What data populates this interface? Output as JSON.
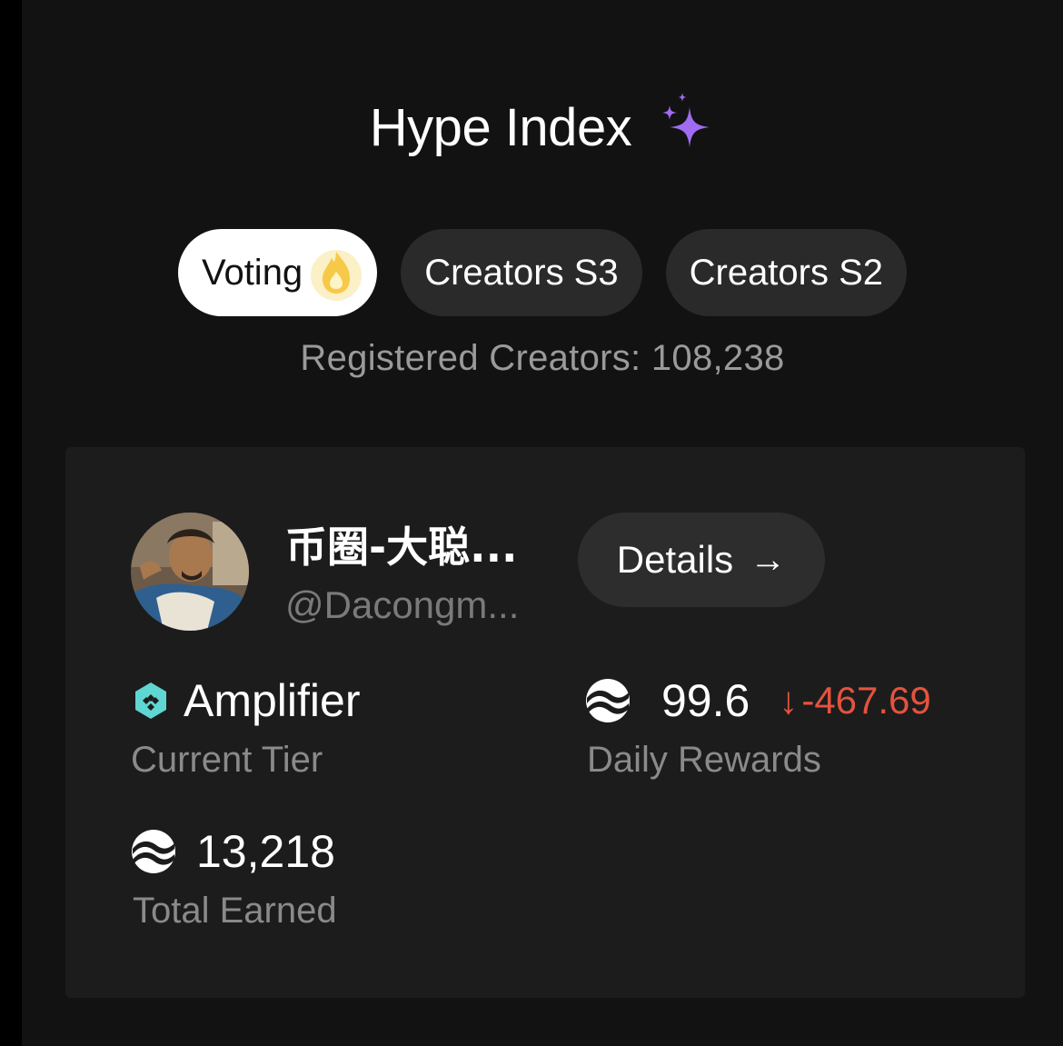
{
  "header": {
    "title": "Hype Index",
    "sparkle_icon": "sparkle-icon",
    "accent": "#a06cf0"
  },
  "tabs": [
    {
      "label": "Voting",
      "active": true,
      "icon": "flame-icon"
    },
    {
      "label": "Creators S3",
      "active": false
    },
    {
      "label": "Creators S2",
      "active": false
    }
  ],
  "registered": "Registered Creators: 108,238",
  "creator": {
    "name": "币圈-大聪...",
    "handle": "@Dacongm...",
    "details_label": "Details",
    "details_arrow": "→"
  },
  "stats": {
    "tier": {
      "value": "Amplifier",
      "label": "Current Tier",
      "icon": "tier-hexagon-icon"
    },
    "daily": {
      "value": "99.6",
      "delta": "-467.69",
      "delta_arrow": "↓",
      "label": "Daily Rewards",
      "icon": "token-icon",
      "delta_color": "#e4533e"
    },
    "total": {
      "value": "13,218",
      "label": "Total Earned",
      "icon": "token-icon"
    }
  }
}
